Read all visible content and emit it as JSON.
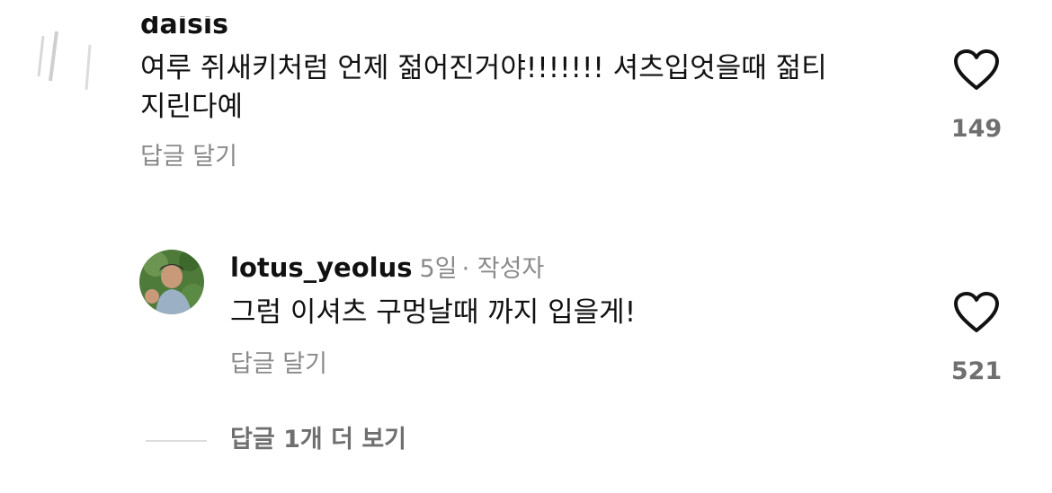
{
  "comment1": {
    "username_partial": "daisis",
    "text_line1": "여루 쥐새키처럼 언제 젊어진거야!!!!!!! 셔츠입엇을때 젊티",
    "text_line2": "지린다예",
    "reply_label": "답글 달기",
    "like_count": "149"
  },
  "comment2": {
    "username": "lotus_yeolus",
    "time": "5일",
    "author_tag": "· 작성자",
    "text": "그럼 이셔츠 구멍날때 까지 입을게!",
    "reply_label": "답글 달기",
    "like_count": "521"
  },
  "more_replies_label": "답글 1개 더 보기",
  "icons": {
    "like": "heart-outline-icon",
    "avatar": "avatar-image"
  },
  "colors": {
    "text": "#111111",
    "muted": "#8a8a8a",
    "count": "#6f6f6f"
  }
}
